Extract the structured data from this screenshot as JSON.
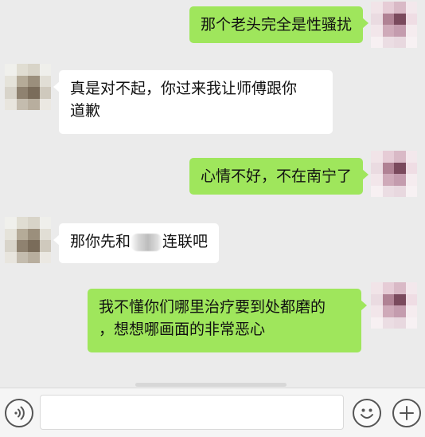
{
  "chat": {
    "messages": [
      {
        "sender": "me",
        "text": "那个老头完全是性骚扰"
      },
      {
        "sender": "other",
        "line1": "真是对不起，你过来我让师傅跟你",
        "line2": "道歉"
      },
      {
        "sender": "me",
        "text": "心情不好，不在南宁了"
      },
      {
        "sender": "other",
        "before": "那你先和",
        "after": "连联吧"
      },
      {
        "sender": "me",
        "line1": "我不懂你们哪里治疗要到处都磨的",
        "line2": "，想想哪画面的非常恶心"
      }
    ]
  },
  "input_bar": {
    "voice_icon": "voice-icon",
    "emoji_icon": "emoji-icon",
    "plus_icon": "plus-icon"
  },
  "colors": {
    "background": "#ebebeb",
    "me_bubble": "#9fe65c",
    "other_bubble": "#ffffff"
  }
}
